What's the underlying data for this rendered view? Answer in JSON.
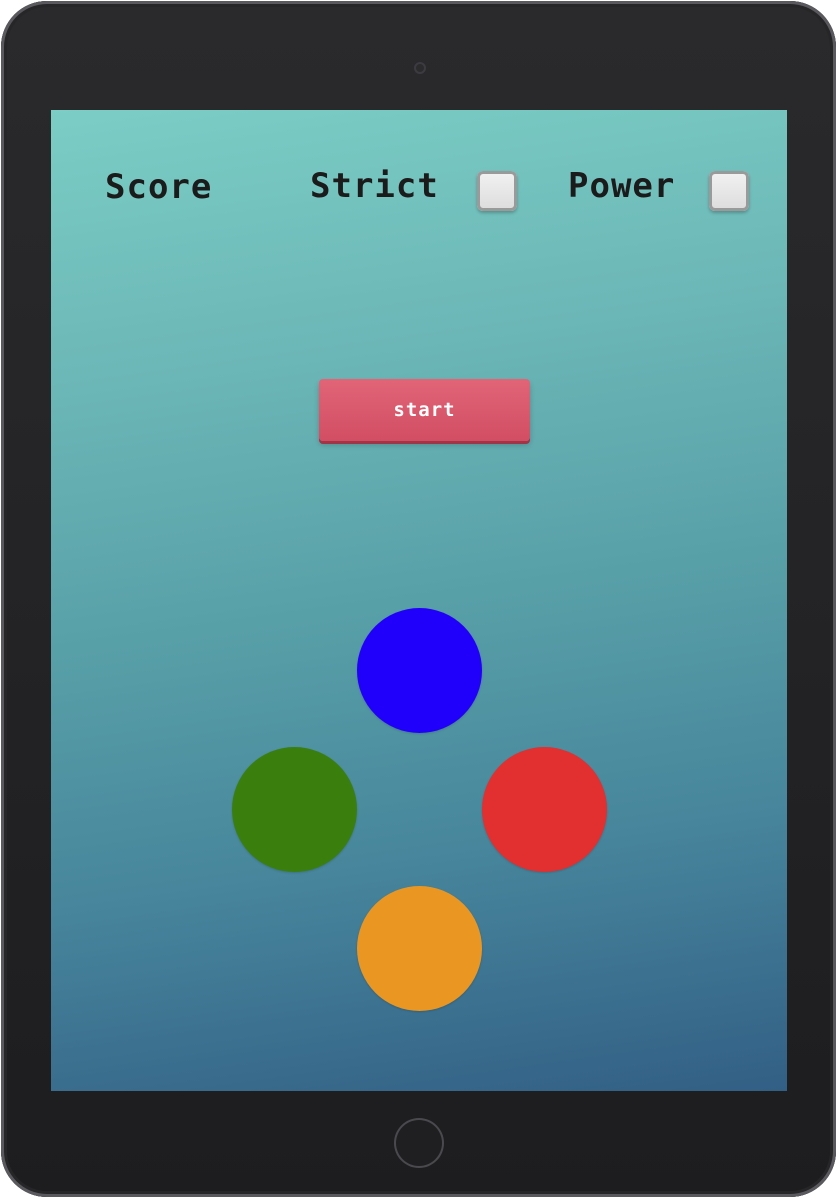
{
  "header": {
    "score_label": "Score",
    "strict_label": "Strict",
    "power_label": "Power"
  },
  "controls": {
    "start_label": "start",
    "strict_checked": false,
    "power_checked": false
  },
  "pads": [
    {
      "id": "blue",
      "color": "#2100fb"
    },
    {
      "id": "green",
      "color": "#3a7f0d"
    },
    {
      "id": "red",
      "color": "#e22f2f"
    },
    {
      "id": "orange",
      "color": "#ea9623"
    }
  ],
  "theme": {
    "start_button_color": "#d9566b",
    "background_top": "#7bcdc5",
    "background_bottom": "#325f85"
  }
}
